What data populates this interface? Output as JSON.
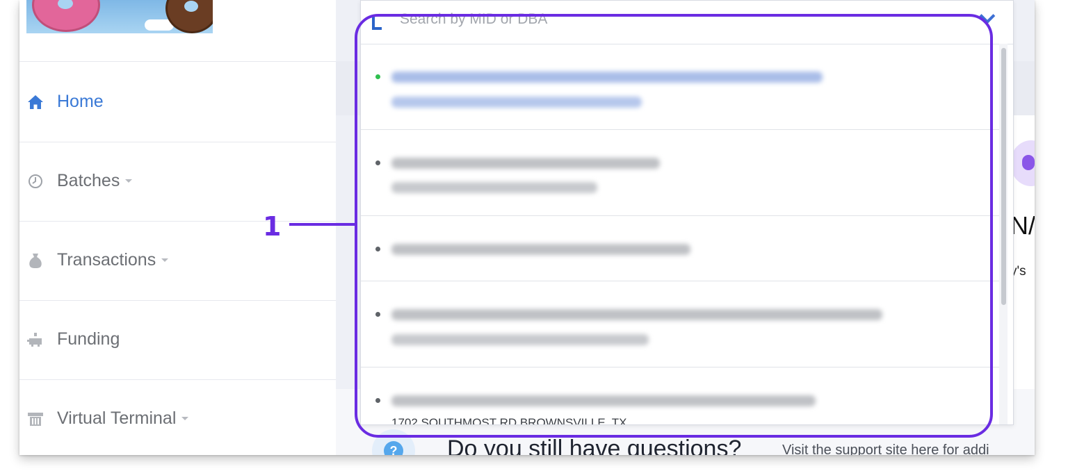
{
  "sidebar": {
    "nav_items": [
      {
        "label": "Home",
        "icon": "home-icon",
        "active": true
      },
      {
        "label": "Batches",
        "icon": "clock-icon",
        "has_caret": true
      },
      {
        "label": "Transactions",
        "icon": "money-bag-icon",
        "has_caret": true
      },
      {
        "label": "Funding",
        "icon": "piggy-bank-icon"
      },
      {
        "label": "Virtual Terminal",
        "icon": "terminal-icon",
        "has_caret": true
      }
    ]
  },
  "search": {
    "placeholder": "Search by MID or DBA",
    "icon": "search-icon"
  },
  "merchant_list": {
    "items": [
      {
        "status": "active",
        "status_color": "#2fbf4f",
        "blurred": true
      },
      {
        "status": "inactive",
        "status_color": "#5f6368",
        "blurred": true
      },
      {
        "status": "inactive",
        "status_color": "#5f6368",
        "blurred": true
      },
      {
        "status": "inactive",
        "status_color": "#5f6368",
        "blurred": true
      },
      {
        "status": "inactive",
        "status_color": "#5f6368",
        "blurred": true,
        "address": "1702 SOUTHMOST RD BROWNSVILLE, TX"
      }
    ]
  },
  "background": {
    "partial_text_1": "N/",
    "partial_text_2": "y's",
    "help_title": "Do you still have questions?",
    "help_text": "Visit the support site here for addi"
  },
  "callout": {
    "number": "1",
    "color": "#6a2ce2"
  },
  "colors": {
    "accent_blue": "#3a79d6",
    "nav_text": "#6c6f74",
    "annotation_purple": "#6a2ce2"
  }
}
